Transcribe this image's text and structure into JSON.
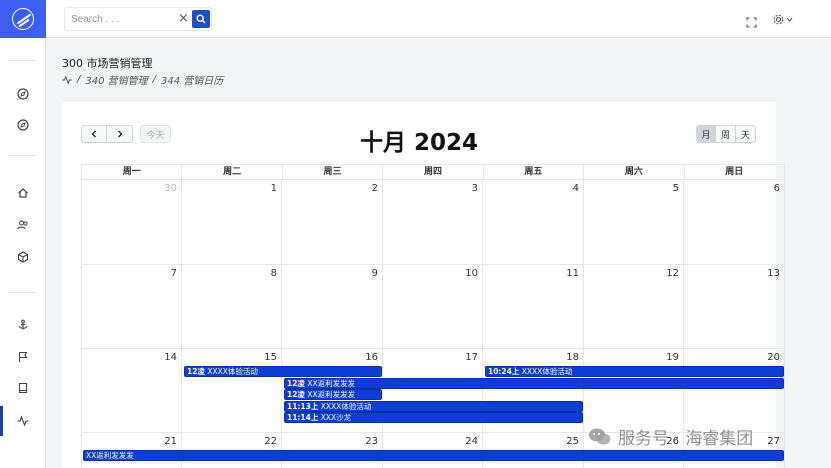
{
  "search": {
    "placeholder": "Search . . ."
  },
  "header": {
    "title": "300 市场营销管理",
    "crumb1": "340 营销管理",
    "sep": "/",
    "crumb2": "344 营销日历"
  },
  "calendar": {
    "title": "十月 2024",
    "today_label": "今天",
    "views": [
      "月",
      "周",
      "天"
    ],
    "weekdays": [
      "周一",
      "周二",
      "周三",
      "周四",
      "周五",
      "周六",
      "周日"
    ],
    "weeks": [
      [
        "30",
        "1",
        "2",
        "3",
        "4",
        "5",
        "6"
      ],
      [
        "7",
        "8",
        "9",
        "10",
        "11",
        "12",
        "13"
      ],
      [
        "14",
        "15",
        "16",
        "17",
        "18",
        "19",
        "20"
      ],
      [
        "21",
        "22",
        "23",
        "24",
        "25",
        "26",
        "27"
      ]
    ],
    "events": [
      {
        "time": "12凌",
        "title": "XXXX体验活动"
      },
      {
        "time": "10:24上",
        "title": "XXXX体验活动"
      },
      {
        "time": "12凌",
        "title": "XX返利发发发"
      },
      {
        "time": "12凌",
        "title": "XX返利发发发"
      },
      {
        "time": "11:13上",
        "title": "XXXX体验活动"
      },
      {
        "time": "11:14上",
        "title": "XXX沙龙"
      },
      {
        "time": "",
        "title": "XX返利发发发"
      }
    ]
  },
  "watermark": {
    "text": "服务号 · 海睿集团"
  },
  "colors": {
    "brand": "#3f5ff3",
    "event": "#0c3ed6",
    "search_button": "#1e4fc4"
  }
}
